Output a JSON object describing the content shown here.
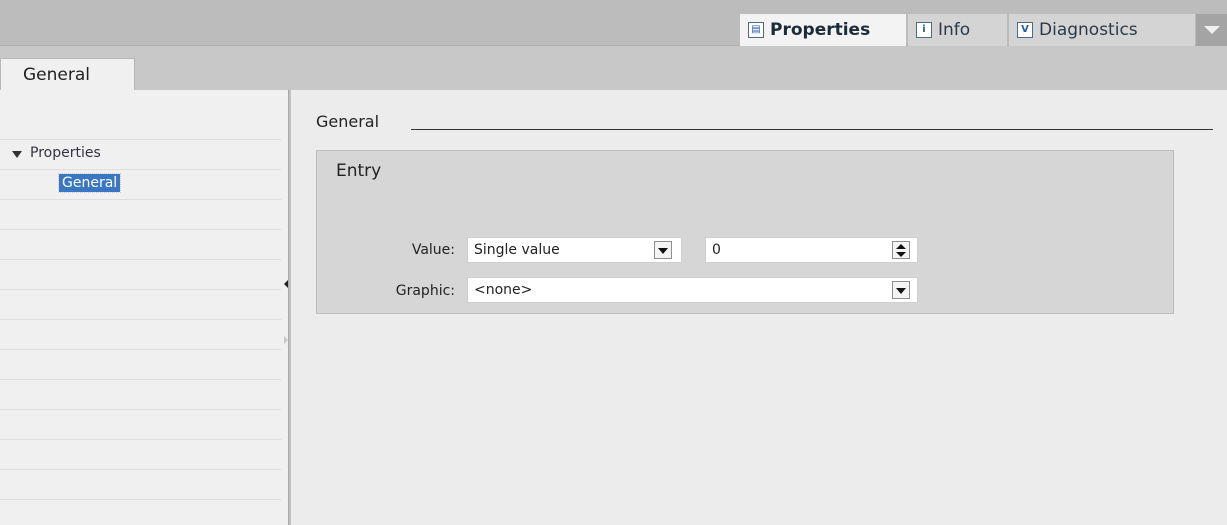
{
  "top_tabs": {
    "properties": {
      "label": "Properties",
      "icon": "properties-icon"
    },
    "info": {
      "label": "Info",
      "icon": "info-icon"
    },
    "diagnostics": {
      "label": "Diagnostics",
      "icon": "diagnostics-icon"
    }
  },
  "subtabs": {
    "general": "General"
  },
  "nav": {
    "properties": "Properties",
    "general": "General"
  },
  "main": {
    "section_title": "General",
    "entry": {
      "title": "Entry",
      "value_label": "Value:",
      "value_mode": "Single value",
      "value_number": "0",
      "graphic_label": "Graphic:",
      "graphic_value": "<none>"
    }
  },
  "colors": {
    "selection": "#3a77c2",
    "topbar": "#bcbcbc",
    "panel": "#d6d6d6"
  }
}
